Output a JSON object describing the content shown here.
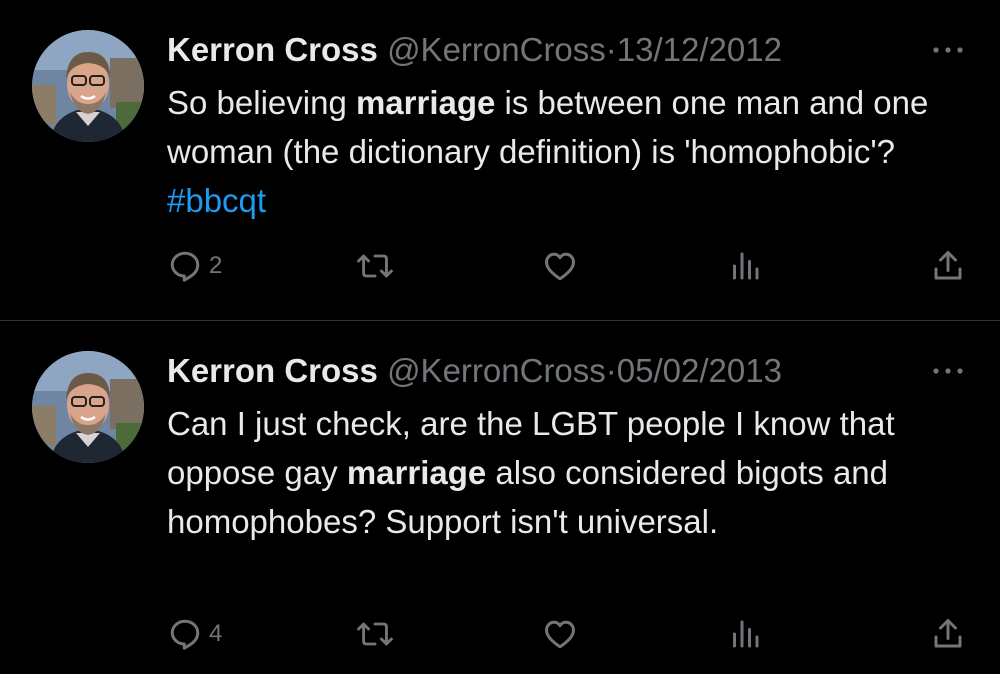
{
  "colors": {
    "background": "#000000",
    "primary_text": "#e7e9ea",
    "secondary_text": "#71767b",
    "link": "#1d9bf0",
    "divider": "#2f3336"
  },
  "icons": {
    "more": "more-horizontal-icon",
    "reply": "reply-icon",
    "retweet": "retweet-icon",
    "like": "heart-icon",
    "views": "views-icon",
    "share": "share-icon"
  },
  "tweets": [
    {
      "name": "Kerron Cross",
      "handle": "@KerronCross",
      "separator": "·",
      "date": "13/12/2012",
      "text": {
        "part1": "So believing ",
        "bold1": "marriage",
        "part2": " is between one man and one woman (the dictionary definition) is 'homophobic'? ",
        "hashtag": "#bbcqt"
      },
      "reply_count": "2"
    },
    {
      "name": "Kerron Cross",
      "handle": "@KerronCross",
      "separator": "·",
      "date": "05/02/2013",
      "text": {
        "part1": "Can I just check, are the LGBT people I know that oppose gay ",
        "bold1": "marriage",
        "part2": " also considered bigots and homophobes? Support isn't universal."
      },
      "reply_count": "4"
    }
  ]
}
